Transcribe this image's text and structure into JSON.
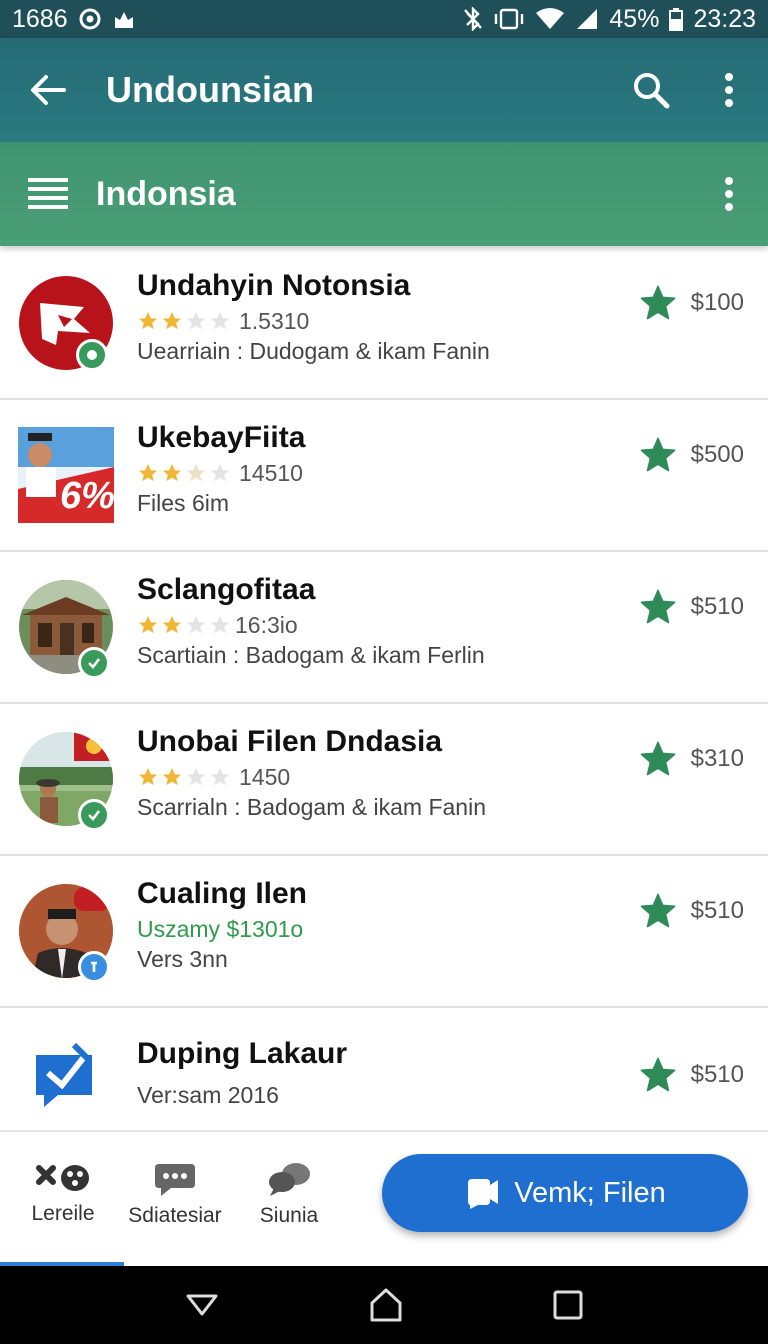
{
  "status_bar": {
    "time_left": "1686",
    "battery": "45%",
    "clock": "23:23"
  },
  "app_bar": {
    "title": "Undounsian"
  },
  "section": {
    "title": "Indonsia"
  },
  "items": [
    {
      "name": "Undahyin Notonsia",
      "rating_text": "1.5310",
      "stars": 2,
      "sub": "Uearriain : Dudogam & ikam Fanin",
      "price": "$100",
      "thumb": "red-logo"
    },
    {
      "name": "UkebayFiita",
      "rating_text": "14510",
      "stars": 2,
      "sub": "Files 6im",
      "price": "$500",
      "thumb": "poster",
      "poster_text": "6%"
    },
    {
      "name": "Sclangofitaa",
      "rating_text": "16:3io",
      "stars": 2,
      "sub": "Scartiain : Badogam & ikam Ferlin",
      "price": "$510",
      "thumb": "house"
    },
    {
      "name": "Unobai Filen Dndasia",
      "rating_text": "1450",
      "stars": 2,
      "sub": "Scarrialn : Badogam & ikam Fanin",
      "price": "$310",
      "thumb": "field"
    },
    {
      "name": "Cualing Ilen",
      "sub_green": "Uszamy $1301o",
      "sub": "Vers 3nn",
      "price": "$510",
      "thumb": "person"
    },
    {
      "name": "Duping Lakaur",
      "sub": "Ver:sam 2016",
      "price": "$510",
      "thumb": "chat"
    }
  ],
  "bottom_nav": {
    "items": [
      {
        "label": "Lereile",
        "icon": "gamepad-icon"
      },
      {
        "label": "Sdiatesiar",
        "icon": "chat-bubble-icon"
      },
      {
        "label": "Siunia",
        "icon": "chat-bubbles-icon"
      }
    ],
    "fab_label": "Vemk; Filen"
  },
  "colors": {
    "app_bar": "#256a75",
    "section_bar": "#3f9470",
    "accent_blue": "#1e6fd0",
    "star_green": "#2e8b57",
    "rating_star": "#f2b632"
  }
}
